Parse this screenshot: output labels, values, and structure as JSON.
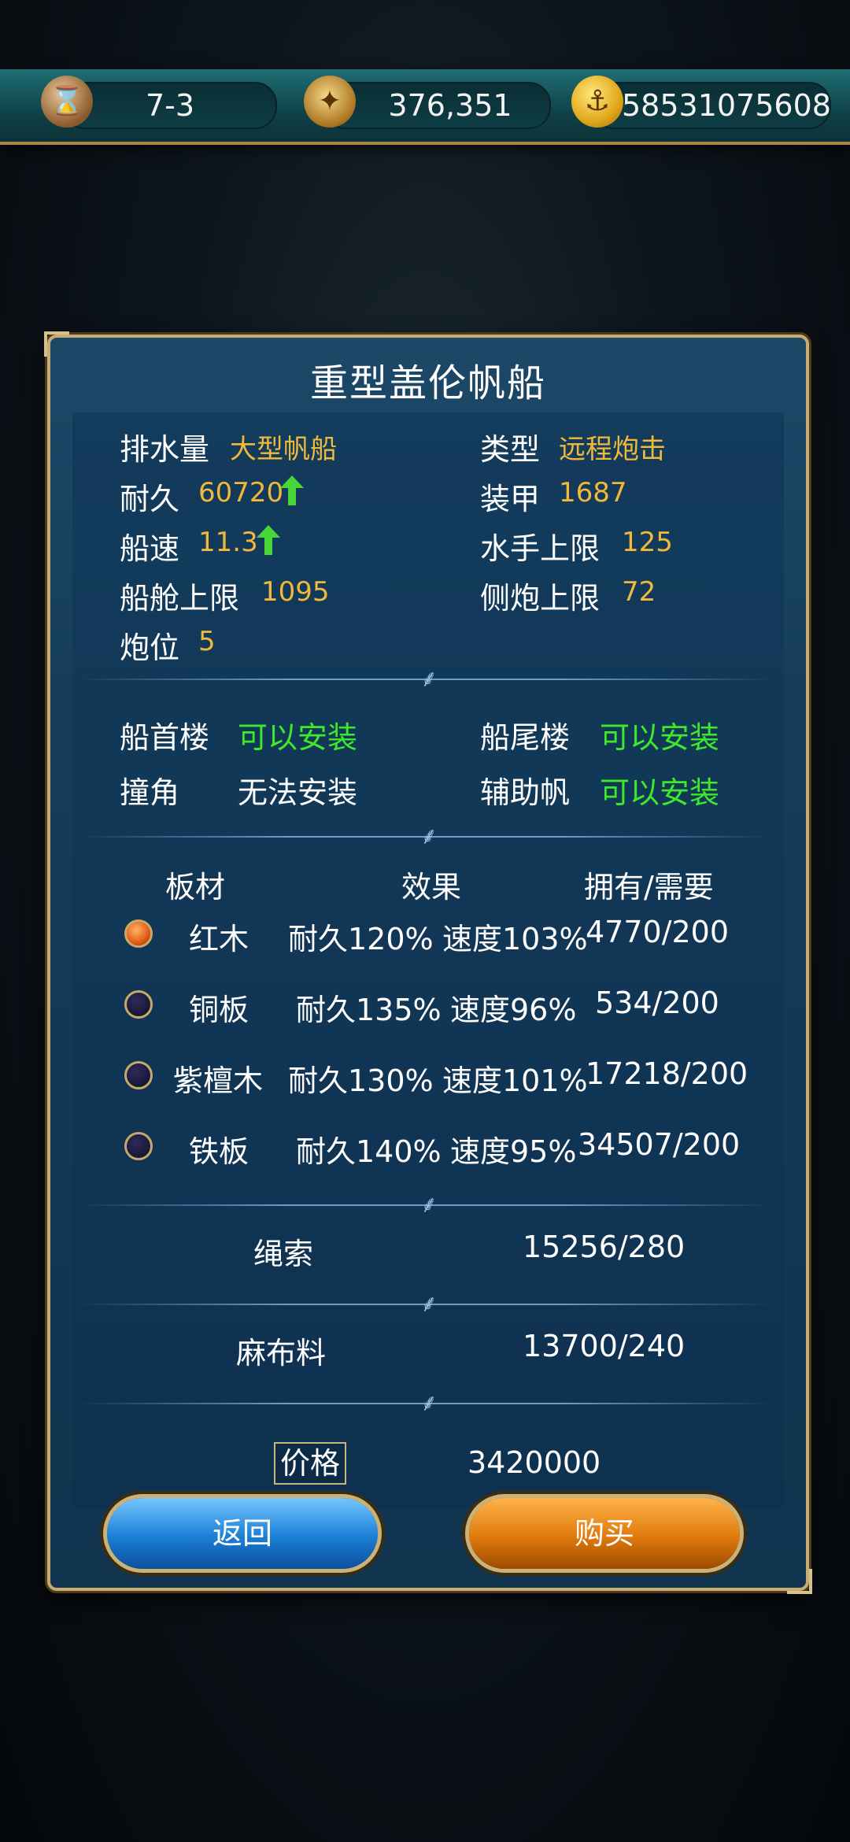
{
  "top_bar": {
    "stage": "7-3",
    "compass_value": "376,351",
    "coins": "58531075608"
  },
  "dialog": {
    "title": "重型盖伦帆船",
    "stats": {
      "displacement_label": "排水量",
      "displacement_value": "大型帆船",
      "type_label": "类型",
      "type_value": "远程炮击",
      "durability_label": "耐久",
      "durability_value": "60720",
      "armor_label": "装甲",
      "armor_value": "1687",
      "speed_label": "船速",
      "speed_value": "11.3",
      "crew_label": "水手上限",
      "crew_value": "125",
      "cargo_label": "船舱上限",
      "cargo_value": "1095",
      "broadside_label": "侧炮上限",
      "broadside_value": "72",
      "gun_slots_label": "炮位",
      "gun_slots_value": "5"
    },
    "installs": {
      "bow_label": "船首楼",
      "bow_value": "可以安装",
      "stern_label": "船尾楼",
      "stern_value": "可以安装",
      "ram_label": "撞角",
      "ram_value": "无法安装",
      "aux_sail_label": "辅助帆",
      "aux_sail_value": "可以安装"
    },
    "planks": {
      "header_material": "板材",
      "header_effect": "效果",
      "header_owned": "拥有/需要",
      "rows": [
        {
          "name": "红木",
          "durability": "耐久120%",
          "speed": "速度103%",
          "owned": "4770/200",
          "selected": true
        },
        {
          "name": "铜板",
          "durability": "耐久135%",
          "speed": "速度96%",
          "owned": "534/200",
          "selected": false
        },
        {
          "name": "紫檀木",
          "durability": "耐久130%",
          "speed": "速度101%",
          "owned": "17218/200",
          "selected": false
        },
        {
          "name": "铁板",
          "durability": "耐久140%",
          "speed": "速度95%",
          "owned": "34507/200",
          "selected": false
        }
      ]
    },
    "materials": {
      "rope_label": "绳索",
      "rope_value": "15256/280",
      "linen_label": "麻布料",
      "linen_value": "13700/240"
    },
    "price_label": "价格",
    "price_value": "3420000",
    "back_label": "返回",
    "buy_label": "购买"
  },
  "colors": {
    "yellow_value": "#f0b93a",
    "green_value": "#3ee82a",
    "panel_blue": "#143a56",
    "gold_border": "#c6ad74"
  }
}
